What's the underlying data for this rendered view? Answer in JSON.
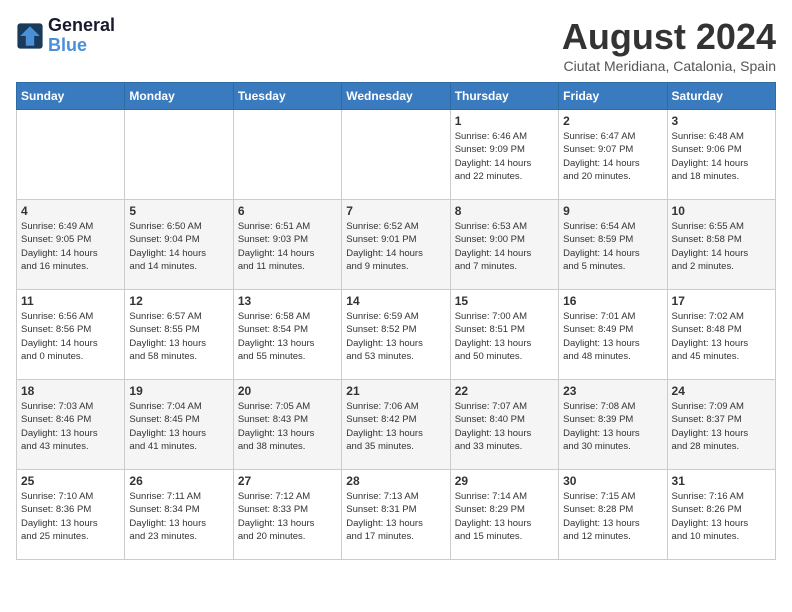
{
  "header": {
    "logo_line1": "General",
    "logo_line2": "Blue",
    "month_title": "August 2024",
    "location": "Ciutat Meridiana, Catalonia, Spain"
  },
  "days_of_week": [
    "Sunday",
    "Monday",
    "Tuesday",
    "Wednesday",
    "Thursday",
    "Friday",
    "Saturday"
  ],
  "weeks": [
    [
      {
        "day": "",
        "info": ""
      },
      {
        "day": "",
        "info": ""
      },
      {
        "day": "",
        "info": ""
      },
      {
        "day": "",
        "info": ""
      },
      {
        "day": "1",
        "info": "Sunrise: 6:46 AM\nSunset: 9:09 PM\nDaylight: 14 hours\nand 22 minutes."
      },
      {
        "day": "2",
        "info": "Sunrise: 6:47 AM\nSunset: 9:07 PM\nDaylight: 14 hours\nand 20 minutes."
      },
      {
        "day": "3",
        "info": "Sunrise: 6:48 AM\nSunset: 9:06 PM\nDaylight: 14 hours\nand 18 minutes."
      }
    ],
    [
      {
        "day": "4",
        "info": "Sunrise: 6:49 AM\nSunset: 9:05 PM\nDaylight: 14 hours\nand 16 minutes."
      },
      {
        "day": "5",
        "info": "Sunrise: 6:50 AM\nSunset: 9:04 PM\nDaylight: 14 hours\nand 14 minutes."
      },
      {
        "day": "6",
        "info": "Sunrise: 6:51 AM\nSunset: 9:03 PM\nDaylight: 14 hours\nand 11 minutes."
      },
      {
        "day": "7",
        "info": "Sunrise: 6:52 AM\nSunset: 9:01 PM\nDaylight: 14 hours\nand 9 minutes."
      },
      {
        "day": "8",
        "info": "Sunrise: 6:53 AM\nSunset: 9:00 PM\nDaylight: 14 hours\nand 7 minutes."
      },
      {
        "day": "9",
        "info": "Sunrise: 6:54 AM\nSunset: 8:59 PM\nDaylight: 14 hours\nand 5 minutes."
      },
      {
        "day": "10",
        "info": "Sunrise: 6:55 AM\nSunset: 8:58 PM\nDaylight: 14 hours\nand 2 minutes."
      }
    ],
    [
      {
        "day": "11",
        "info": "Sunrise: 6:56 AM\nSunset: 8:56 PM\nDaylight: 14 hours\nand 0 minutes."
      },
      {
        "day": "12",
        "info": "Sunrise: 6:57 AM\nSunset: 8:55 PM\nDaylight: 13 hours\nand 58 minutes."
      },
      {
        "day": "13",
        "info": "Sunrise: 6:58 AM\nSunset: 8:54 PM\nDaylight: 13 hours\nand 55 minutes."
      },
      {
        "day": "14",
        "info": "Sunrise: 6:59 AM\nSunset: 8:52 PM\nDaylight: 13 hours\nand 53 minutes."
      },
      {
        "day": "15",
        "info": "Sunrise: 7:00 AM\nSunset: 8:51 PM\nDaylight: 13 hours\nand 50 minutes."
      },
      {
        "day": "16",
        "info": "Sunrise: 7:01 AM\nSunset: 8:49 PM\nDaylight: 13 hours\nand 48 minutes."
      },
      {
        "day": "17",
        "info": "Sunrise: 7:02 AM\nSunset: 8:48 PM\nDaylight: 13 hours\nand 45 minutes."
      }
    ],
    [
      {
        "day": "18",
        "info": "Sunrise: 7:03 AM\nSunset: 8:46 PM\nDaylight: 13 hours\nand 43 minutes."
      },
      {
        "day": "19",
        "info": "Sunrise: 7:04 AM\nSunset: 8:45 PM\nDaylight: 13 hours\nand 41 minutes."
      },
      {
        "day": "20",
        "info": "Sunrise: 7:05 AM\nSunset: 8:43 PM\nDaylight: 13 hours\nand 38 minutes."
      },
      {
        "day": "21",
        "info": "Sunrise: 7:06 AM\nSunset: 8:42 PM\nDaylight: 13 hours\nand 35 minutes."
      },
      {
        "day": "22",
        "info": "Sunrise: 7:07 AM\nSunset: 8:40 PM\nDaylight: 13 hours\nand 33 minutes."
      },
      {
        "day": "23",
        "info": "Sunrise: 7:08 AM\nSunset: 8:39 PM\nDaylight: 13 hours\nand 30 minutes."
      },
      {
        "day": "24",
        "info": "Sunrise: 7:09 AM\nSunset: 8:37 PM\nDaylight: 13 hours\nand 28 minutes."
      }
    ],
    [
      {
        "day": "25",
        "info": "Sunrise: 7:10 AM\nSunset: 8:36 PM\nDaylight: 13 hours\nand 25 minutes."
      },
      {
        "day": "26",
        "info": "Sunrise: 7:11 AM\nSunset: 8:34 PM\nDaylight: 13 hours\nand 23 minutes."
      },
      {
        "day": "27",
        "info": "Sunrise: 7:12 AM\nSunset: 8:33 PM\nDaylight: 13 hours\nand 20 minutes."
      },
      {
        "day": "28",
        "info": "Sunrise: 7:13 AM\nSunset: 8:31 PM\nDaylight: 13 hours\nand 17 minutes."
      },
      {
        "day": "29",
        "info": "Sunrise: 7:14 AM\nSunset: 8:29 PM\nDaylight: 13 hours\nand 15 minutes."
      },
      {
        "day": "30",
        "info": "Sunrise: 7:15 AM\nSunset: 8:28 PM\nDaylight: 13 hours\nand 12 minutes."
      },
      {
        "day": "31",
        "info": "Sunrise: 7:16 AM\nSunset: 8:26 PM\nDaylight: 13 hours\nand 10 minutes."
      }
    ]
  ]
}
